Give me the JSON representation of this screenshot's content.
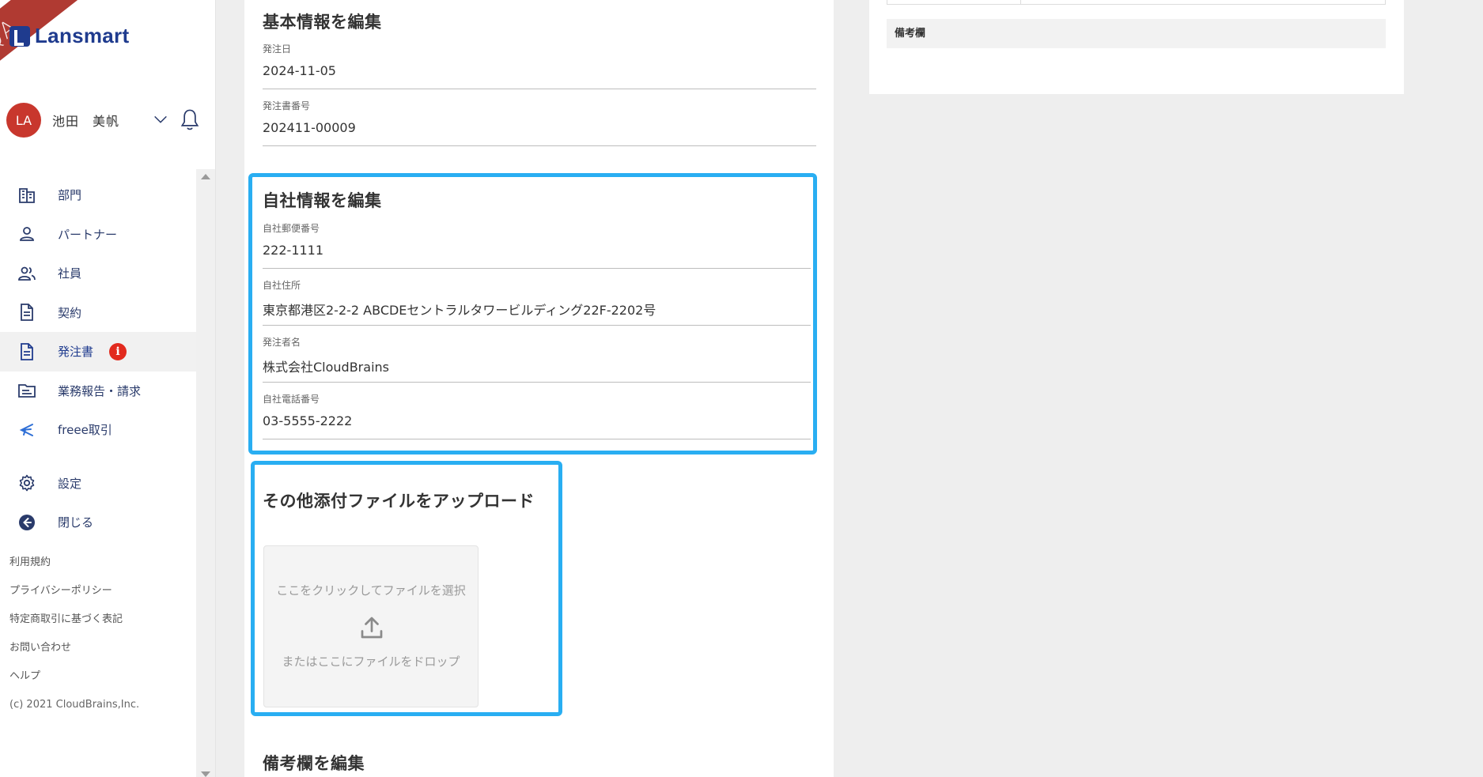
{
  "brand": {
    "logo_text": "Lansmart",
    "ribbon_text": "QA"
  },
  "user": {
    "initials": "LA",
    "name": "池田　美帆"
  },
  "nav": {
    "items": [
      {
        "label": "部門",
        "icon": "building-icon"
      },
      {
        "label": "パートナー",
        "icon": "person-icon"
      },
      {
        "label": "社員",
        "icon": "people-icon"
      },
      {
        "label": "契約",
        "icon": "document-icon"
      },
      {
        "label": "発注書",
        "icon": "document-icon",
        "active": true,
        "badge": "i"
      },
      {
        "label": "業務報告・請求",
        "icon": "folder-icon"
      },
      {
        "label": "freee取引",
        "icon": "freee-icon"
      }
    ],
    "settings_label": "設定",
    "close_label": "閉じる"
  },
  "footer": {
    "links": [
      "利用規約",
      "プライバシーポリシー",
      "特定商取引に基づく表記",
      "お問い合わせ",
      "ヘルプ"
    ],
    "copyright": "(c) 2021 CloudBrains,Inc."
  },
  "basic_info": {
    "title": "基本情報を編集",
    "order_date_label": "発注日",
    "order_date_value": "2024-11-05",
    "order_no_label": "発注書番号",
    "order_no_value": "202411-00009"
  },
  "company_info": {
    "title": "自社情報を編集",
    "postal_label": "自社郵便番号",
    "postal_value": "222-1111",
    "address_label": "自社住所",
    "address_value": "東京都港区2-2-2 ABCDEセントラルタワービルディング22F-2202号",
    "orderer_label": "発注者名",
    "orderer_value": "株式会社CloudBrains",
    "phone_label": "自社電話番号",
    "phone_value": "03-5555-2222"
  },
  "upload": {
    "title": "その他添付ファイルをアップロード",
    "click_text": "ここをクリックしてファイルを選択",
    "drop_text": "またはここにファイルをドロップ"
  },
  "remarks": {
    "title": "備考欄を編集"
  },
  "right_panel": {
    "remarks_label": "備考欄"
  },
  "colors": {
    "highlight": "#29aef2",
    "brand": "#1f3b8e",
    "badge": "#e22a1e",
    "avatar": "#c8372d"
  }
}
